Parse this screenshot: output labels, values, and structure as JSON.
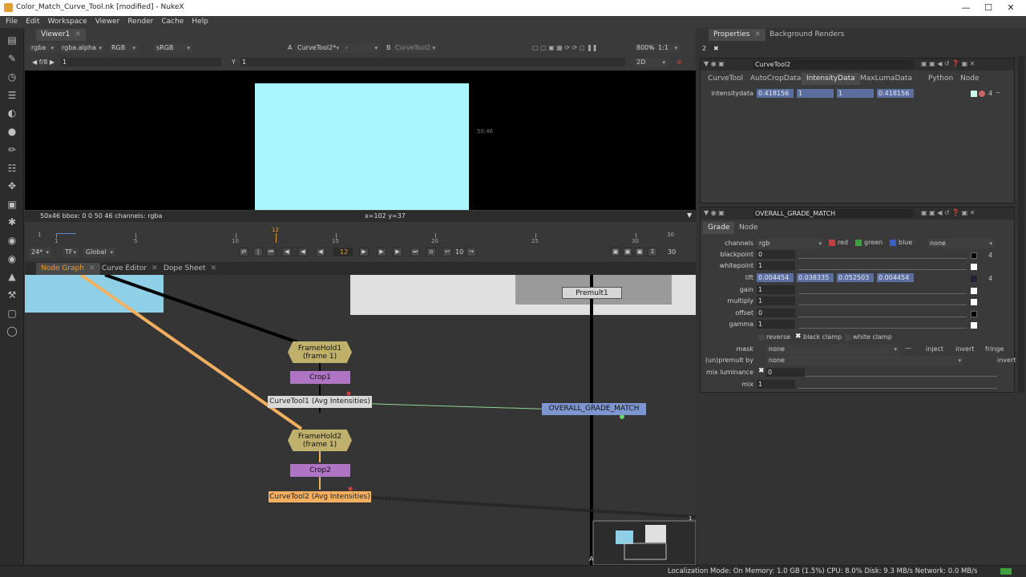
{
  "window": {
    "title": "Color_Match_Curve_Tool.nk [modified] - NukeX"
  },
  "menu": [
    "File",
    "Edit",
    "Workspace",
    "Viewer",
    "Render",
    "Cache",
    "Help"
  ],
  "viewer": {
    "tab": "Viewer1",
    "channels": "rgba",
    "alpha": "rgba.alpha",
    "colorspace_mode": "RGB",
    "lut": "sRGB",
    "input_a_label": "A",
    "input_a": "CurveTool2*",
    "input_a_op": "-",
    "input_b_label": "B",
    "input_b": "CurveTool2",
    "zoom": "800%",
    "proxy": "1:1",
    "view_mode": "2D",
    "fstop": "f/8",
    "gain_value": "1",
    "gamma_label": "Y",
    "gamma_value": "1",
    "image_label": "50,46",
    "info_left": "50x46  bbox: 0 0 50 46 channels: rgba",
    "info_coords": "x=102 y=37"
  },
  "timeline": {
    "start": "1",
    "end": "30",
    "current_frame": "12",
    "ticks": [
      "1",
      "5",
      "10",
      "15",
      "20",
      "25",
      "30"
    ],
    "fps": "24*",
    "tf": "TF",
    "scope": "Global",
    "frame_field": "12",
    "step": "10",
    "end_field": "30"
  },
  "nodegraph": {
    "tabs": [
      "Node Graph",
      "Curve Editor",
      "Dope Sheet"
    ],
    "nodes": {
      "premult": "Premult1",
      "framehold1_a": "FrameHold1",
      "framehold1_b": "(frame 1)",
      "crop1": "Crop1",
      "curvetool1": "CurveTool1 (Avg Intensities)",
      "overall": "OVERALL_GRADE_MATCH",
      "framehold2_a": "FrameHold2",
      "framehold2_b": "(frame 1)",
      "crop2": "Crop2",
      "curvetool2": "CurveTool2 (Avg Intensities)"
    },
    "minimap_label": "A",
    "edge_label": "1"
  },
  "properties": {
    "tabs": [
      "Properties",
      "Background Renders"
    ],
    "count": "2",
    "curvetool": {
      "name": "CurveTool2",
      "tabs": [
        "CurveTool",
        "AutoCropData",
        "IntensityData",
        "MaxLumaData",
        "Python",
        "Node"
      ],
      "field_label": "intensitydata",
      "values": [
        "0.418156",
        "1",
        "1",
        "0.418156"
      ],
      "count": "4"
    },
    "grade": {
      "name": "OVERALL_GRADE_MATCH",
      "tabs": [
        "Grade",
        "Node"
      ],
      "channels_label": "channels",
      "channels": "rgb",
      "ch_red": "red",
      "ch_green": "green",
      "ch_blue": "blue",
      "ch_extra": "none",
      "rows": [
        {
          "label": "blackpoint",
          "value": "0"
        },
        {
          "label": "whitepoint",
          "value": "1"
        },
        {
          "label": "gain",
          "value": "1"
        },
        {
          "label": "multiply",
          "value": "1"
        },
        {
          "label": "offset",
          "value": "0"
        },
        {
          "label": "gamma",
          "value": "1"
        }
      ],
      "lift_label": "lift",
      "lift_values": [
        "0.004454",
        "0.038335",
        "0.052503",
        "0.004454"
      ],
      "row_count": "4",
      "reverse": "reverse",
      "black_clamp": "black clamp",
      "white_clamp": "white clamp",
      "mask_label": "mask",
      "mask": "none",
      "inject": "inject",
      "invert": "invert",
      "fringe": "fringe",
      "unpremult_label": "(un)premult by",
      "unpremult": "none",
      "invert2": "invert",
      "mixlum_label": "mix luminance",
      "mixlum_value": "0",
      "mix_label": "mix",
      "mix_value": "1"
    }
  },
  "status": "Localization Mode: On Memory: 1.0 GB (1.5%) CPU: 8.0% Disk: 9.3 MB/s Network: 0.0 MB/s"
}
